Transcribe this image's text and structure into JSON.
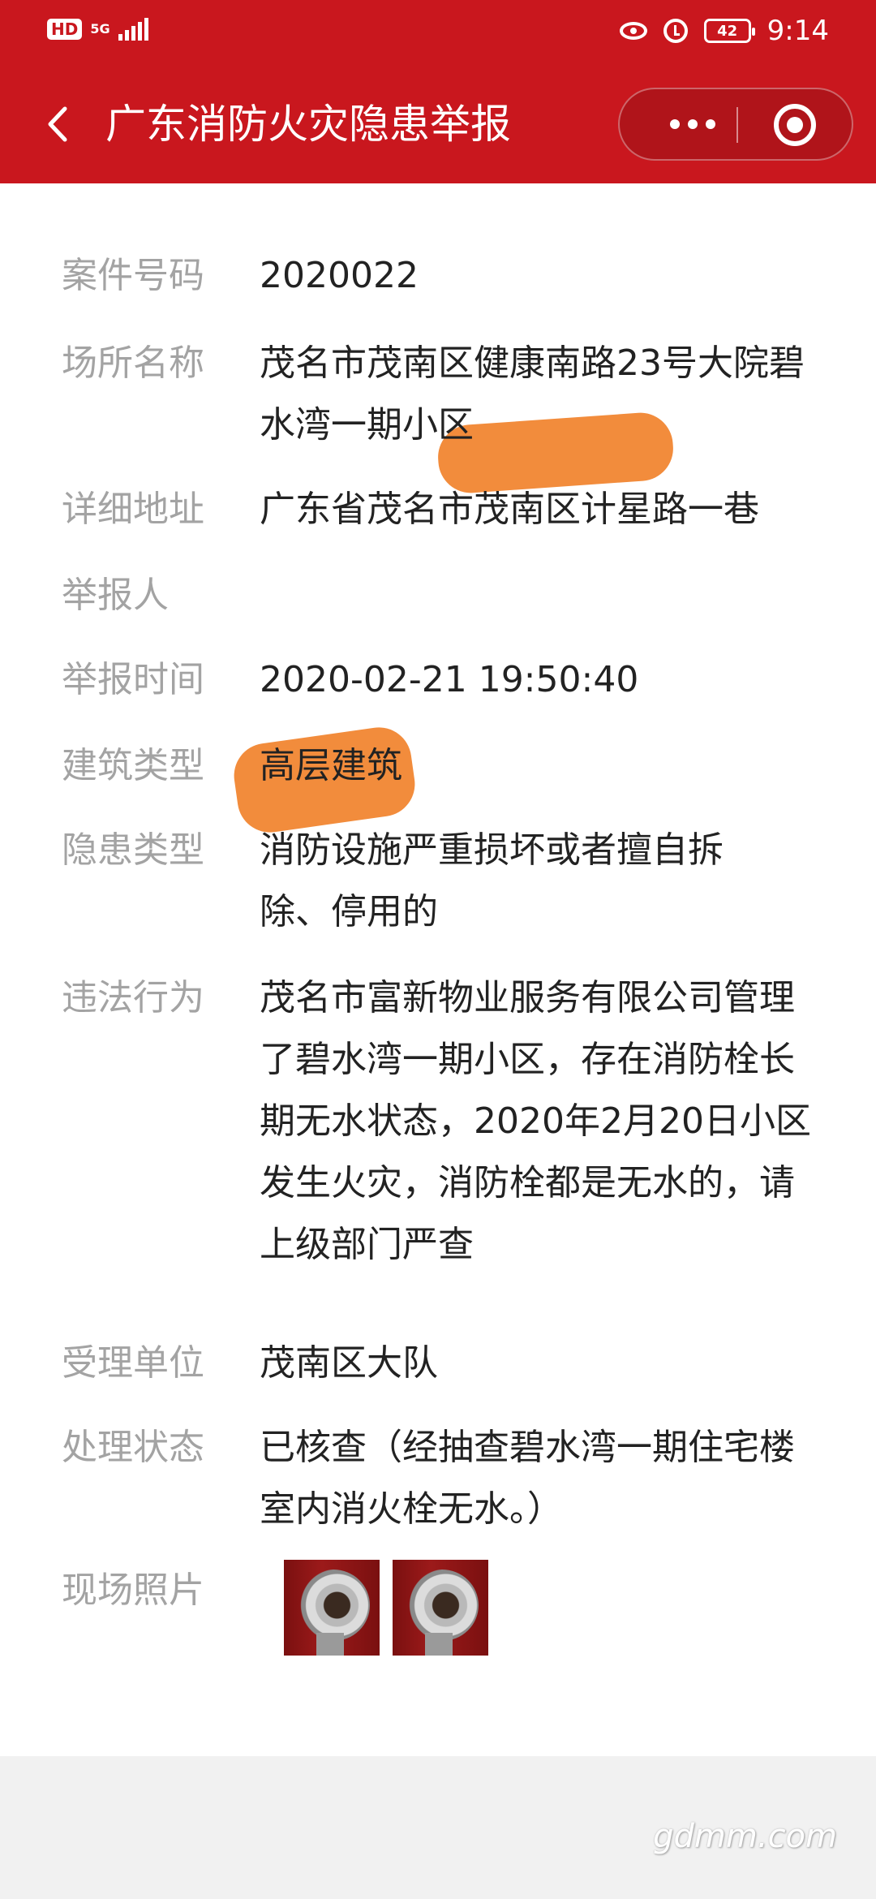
{
  "status_bar": {
    "hd": "HD",
    "network": "5G",
    "battery": "42",
    "time": "9:14"
  },
  "nav": {
    "title": "广东消防火灾隐患举报"
  },
  "fields": [
    {
      "label": "案件号码",
      "value": "2020022"
    },
    {
      "label": "场所名称",
      "value": "茂名市茂南区健康南路23号大院碧水湾一期小区"
    },
    {
      "label": "详细地址",
      "value": "广东省茂名市茂南区计星路一巷"
    },
    {
      "label": "举报人",
      "value": ""
    },
    {
      "label": "举报时间",
      "value": "2020-02-21 19:50:40"
    },
    {
      "label": "建筑类型",
      "value": "高层建筑"
    },
    {
      "label": "隐患类型",
      "value": "消防设施严重损坏或者擅自拆除、停用的"
    },
    {
      "label": "违法行为",
      "value": "茂名市富新物业服务有限公司管理了碧水湾一期小区，存在消防栓长期无水状态，2020年2月20日小区发生火灾，消防栓都是无水的，请上级部门严查"
    },
    {
      "label": "受理单位",
      "value": "茂南区大队"
    },
    {
      "label": "处理状态",
      "value": "已核查（经抽查碧水湾一期住宅楼室内消火栓无水。）"
    },
    {
      "label": "现场照片",
      "value": ""
    }
  ],
  "watermark": "gdmm.com",
  "colors": {
    "header": "#c9171e",
    "label": "#a3a3a3",
    "value": "#222222",
    "redaction": "#f28c3c"
  }
}
